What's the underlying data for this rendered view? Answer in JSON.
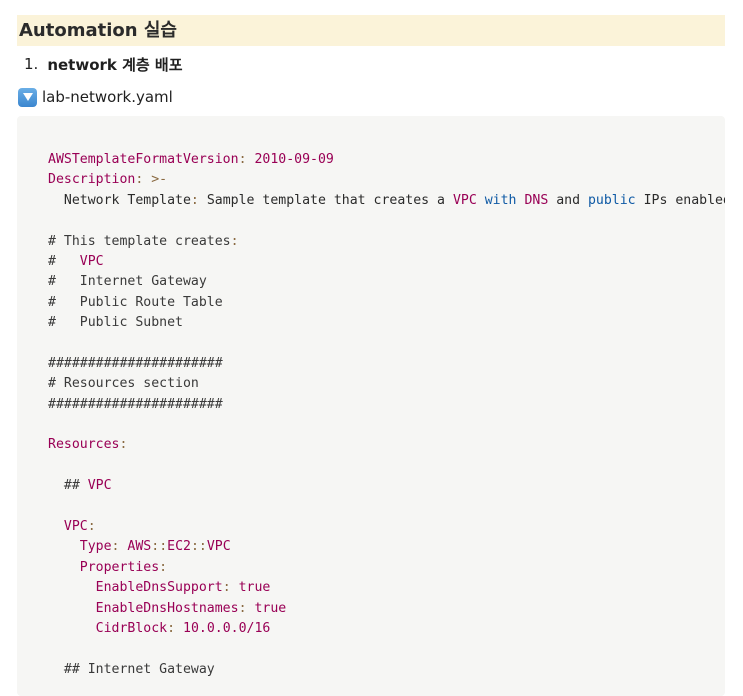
{
  "heading": "Automation 실습",
  "list": {
    "number": "1.",
    "text": "network 계층 배포"
  },
  "toggle": {
    "icon": "down-triangle-icon",
    "label": "lab-network.yaml"
  },
  "code": {
    "lines": [
      [
        {
          "t": "AWSTemplateFormatVersion",
          "c": "k"
        },
        {
          "t": ": ",
          "c": "p"
        },
        {
          "t": "2010-09-09",
          "c": "v"
        }
      ],
      [
        {
          "t": "Description",
          "c": "k"
        },
        {
          "t": ": ",
          "c": "p"
        },
        {
          "t": ">-",
          "c": "p"
        }
      ],
      [
        {
          "t": "  Network Template",
          "c": ""
        },
        {
          "t": ":",
          "c": "p"
        },
        {
          "t": " Sample template that creates a ",
          "c": ""
        },
        {
          "t": "VPC",
          "c": "k"
        },
        {
          "t": " ",
          "c": ""
        },
        {
          "t": "with",
          "c": "b"
        },
        {
          "t": " ",
          "c": ""
        },
        {
          "t": "DNS",
          "c": "k"
        },
        {
          "t": " and ",
          "c": ""
        },
        {
          "t": "public",
          "c": "b"
        },
        {
          "t": " IPs enabled",
          "c": ""
        }
      ],
      [],
      [
        {
          "t": "# This template creates",
          "c": "c"
        },
        {
          "t": ":",
          "c": "p"
        }
      ],
      [
        {
          "t": "#   ",
          "c": "c"
        },
        {
          "t": "VPC",
          "c": "k"
        }
      ],
      [
        {
          "t": "#   Internet Gateway",
          "c": "c"
        }
      ],
      [
        {
          "t": "#   Public Route Table",
          "c": "c"
        }
      ],
      [
        {
          "t": "#   Public Subnet",
          "c": "c"
        }
      ],
      [],
      [
        {
          "t": "######################",
          "c": "c"
        }
      ],
      [
        {
          "t": "# Resources section",
          "c": "c"
        }
      ],
      [
        {
          "t": "######################",
          "c": "c"
        }
      ],
      [],
      [
        {
          "t": "Resources",
          "c": "k"
        },
        {
          "t": ":",
          "c": "p"
        }
      ],
      [],
      [
        {
          "t": "  ## ",
          "c": "c"
        },
        {
          "t": "VPC",
          "c": "k"
        }
      ],
      [],
      [
        {
          "t": "  ",
          "c": ""
        },
        {
          "t": "VPC",
          "c": "k"
        },
        {
          "t": ":",
          "c": "p"
        }
      ],
      [
        {
          "t": "    ",
          "c": ""
        },
        {
          "t": "Type",
          "c": "k"
        },
        {
          "t": ": ",
          "c": "p"
        },
        {
          "t": "AWS",
          "c": "v"
        },
        {
          "t": "::",
          "c": "p"
        },
        {
          "t": "EC2",
          "c": "v"
        },
        {
          "t": "::",
          "c": "p"
        },
        {
          "t": "VPC",
          "c": "v"
        }
      ],
      [
        {
          "t": "    ",
          "c": ""
        },
        {
          "t": "Properties",
          "c": "k"
        },
        {
          "t": ":",
          "c": "p"
        }
      ],
      [
        {
          "t": "      ",
          "c": ""
        },
        {
          "t": "EnableDnsSupport",
          "c": "k"
        },
        {
          "t": ": ",
          "c": "p"
        },
        {
          "t": "true",
          "c": "v"
        }
      ],
      [
        {
          "t": "      ",
          "c": ""
        },
        {
          "t": "EnableDnsHostnames",
          "c": "k"
        },
        {
          "t": ": ",
          "c": "p"
        },
        {
          "t": "true",
          "c": "v"
        }
      ],
      [
        {
          "t": "      ",
          "c": ""
        },
        {
          "t": "CidrBlock",
          "c": "k"
        },
        {
          "t": ": ",
          "c": "p"
        },
        {
          "t": "10.0.0.0/16",
          "c": "v"
        }
      ],
      [],
      [
        {
          "t": "  ## Internet Gateway",
          "c": "c"
        }
      ]
    ]
  },
  "colors": {
    "heading_bg": "#fbf3d9",
    "code_bg": "#f6f6f4",
    "key": "#990055",
    "keyword": "#0f5aa5",
    "punctuation": "#8a6a42"
  }
}
